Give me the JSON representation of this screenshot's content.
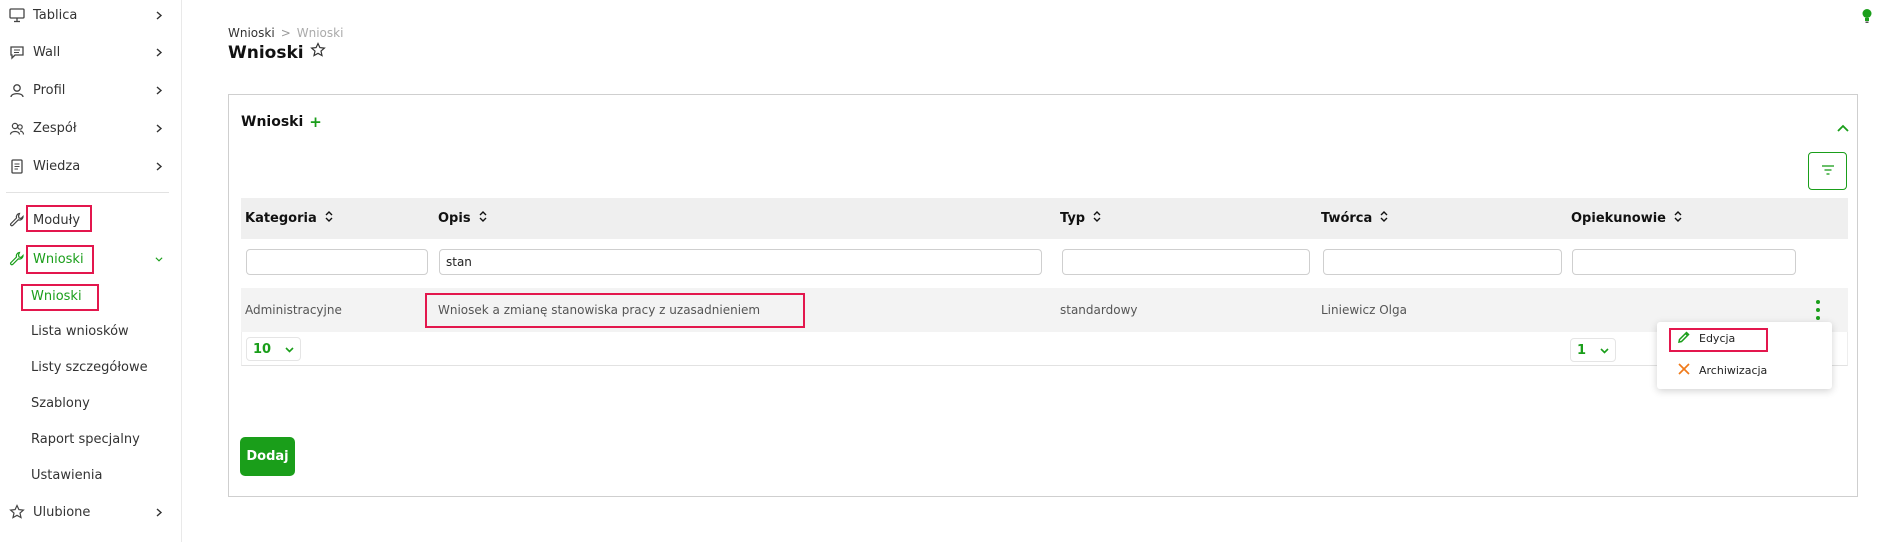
{
  "sidebar": {
    "items": [
      {
        "label": "Tablica",
        "icon": "monitor-icon"
      },
      {
        "label": "Wall",
        "icon": "chat-icon"
      },
      {
        "label": "Profil",
        "icon": "user-icon"
      },
      {
        "label": "Zespół",
        "icon": "team-icon"
      },
      {
        "label": "Wiedza",
        "icon": "document-icon"
      }
    ],
    "modules_label": "Moduły",
    "wnioski_label": "Wnioski",
    "sub_items": [
      "Wnioski",
      "Lista wniosków",
      "Listy szczegółowe",
      "Szablony",
      "Raport specjalny",
      "Ustawienia"
    ],
    "favorites_label": "Ulubione"
  },
  "header": {
    "breadcrumb": [
      "Wnioski",
      ">",
      "Wnioski"
    ],
    "title": "Wnioski"
  },
  "panel": {
    "title": "Wnioski",
    "plus": "+",
    "columns": [
      "Kategoria",
      "Opis",
      "Typ",
      "Twórca",
      "Opiekunowie"
    ],
    "filters": {
      "kategoria": "",
      "opis": "stan",
      "typ": "",
      "tworca": "",
      "opiekunowie": ""
    },
    "rows": [
      {
        "kategoria": "Administracyjne",
        "opis": "Wniosek a zmianę stanowiska pracy z uzasadnieniem",
        "typ": "standardowy",
        "tworca": "Liniewicz Olga",
        "opiekunowie": ""
      }
    ],
    "page_size": "10",
    "page": "1",
    "add_label": "Dodaj"
  },
  "context_menu": {
    "edit_label": "Edycja",
    "archive_label": "Archiwizacja"
  },
  "colors": {
    "accent": "#1a9e1a",
    "highlight": "#e3174d",
    "archive": "#f07a1a"
  }
}
